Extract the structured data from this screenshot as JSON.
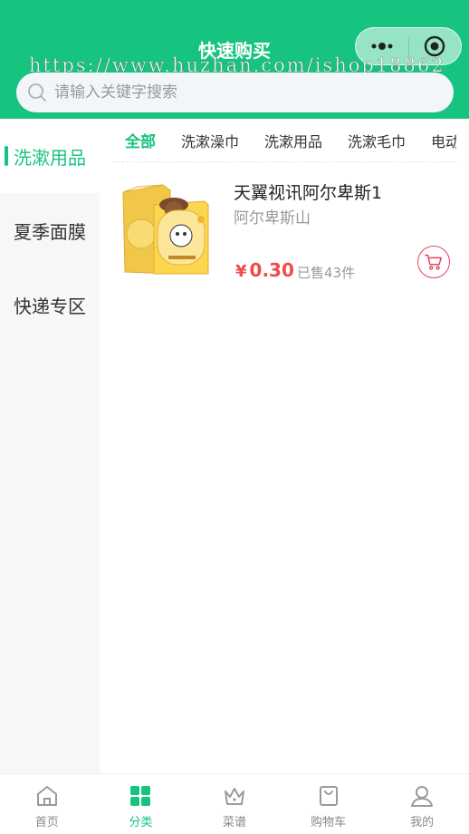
{
  "header": {
    "title": "快速购买",
    "watermark": "https://www.huzhan.com/ishop18862",
    "search_placeholder": "请输入关键字搜索"
  },
  "sidebar": {
    "items": [
      {
        "label": "洗漱用品",
        "active": true
      },
      {
        "label": "夏季面膜",
        "active": false
      },
      {
        "label": "快递专区",
        "active": false
      }
    ]
  },
  "tabs": [
    {
      "label": "全部",
      "active": true
    },
    {
      "label": "洗漱澡巾",
      "active": false
    },
    {
      "label": "洗漱用品",
      "active": false
    },
    {
      "label": "洗漱毛巾",
      "active": false
    },
    {
      "label": "电动",
      "active": false
    }
  ],
  "product": {
    "name": "天翼视讯阿尔卑斯1",
    "subtitle": "阿尔卑斯山",
    "currency": "¥",
    "price": "0.30",
    "sold": "已售43件",
    "image": "face-mask-package"
  },
  "tabbar": {
    "items": [
      {
        "label": "首页",
        "icon": "home-icon",
        "active": false
      },
      {
        "label": "分类",
        "icon": "category-icon",
        "active": true
      },
      {
        "label": "菜谱",
        "icon": "crown-icon",
        "active": false
      },
      {
        "label": "购物车",
        "icon": "bag-icon",
        "active": false
      },
      {
        "label": "我的",
        "icon": "user-icon",
        "active": false
      }
    ]
  },
  "colors": {
    "primary": "#17c47f",
    "price": "#f04b4b",
    "cart_border": "#e3455b"
  }
}
